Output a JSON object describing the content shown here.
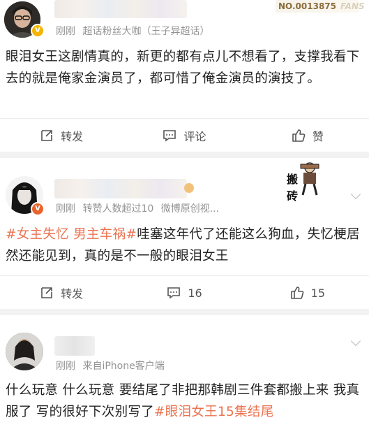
{
  "post1": {
    "fans_number": "NO.0013875",
    "fans_label": "FANS",
    "time": "刚刚",
    "source": "超话粉丝大咖（王子异超话）",
    "text": "眼泪女王这剧情真的，新更的都有点儿不想看了，支撑我看下去的就是俺家金演员了，都可惜了俺金演员的演技了。",
    "actions": {
      "repost": "转发",
      "comment": "评论",
      "like": "赞"
    }
  },
  "post2": {
    "time": "刚刚",
    "tag": "转赞人数超过10",
    "source": "微博原创视...",
    "meme_text": "搬砖",
    "topic1": "#女主失忆",
    "topic2": "男主车祸#",
    "text": "哇塞这年代了还能这么狗血，失忆梗居然还能见到，真的是不一般的眼泪女王",
    "actions": {
      "repost": "转发",
      "comment": "16",
      "like": "15"
    }
  },
  "post3": {
    "time": "刚刚",
    "source": "来自iPhone客户端",
    "text": "什么玩意 什么玩意 要结尾了非把那韩剧三件套都搬上来 我真服了 写的很好下次别写了",
    "topic": "#眼泪女王15集结尾"
  },
  "colors": {
    "topic": "#eb7350",
    "meta": "#939393",
    "separator": "#f2f2f2"
  }
}
